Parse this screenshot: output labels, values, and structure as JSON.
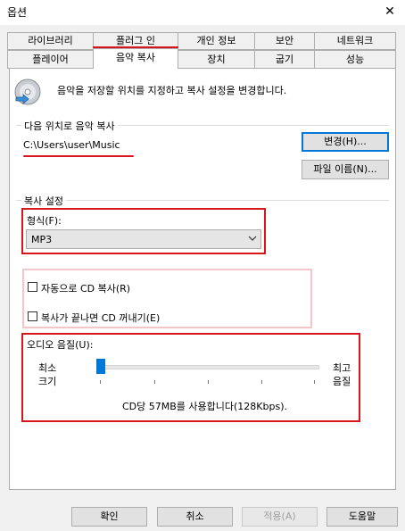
{
  "window": {
    "title": "옵션",
    "close_glyph": "✕"
  },
  "tabs_row1": [
    "라이브러리",
    "플러그 인",
    "개인 정보",
    "보안",
    "네트워크"
  ],
  "tabs_row2": [
    "플레이어",
    "음악 복사",
    "장치",
    "굽기",
    "성능"
  ],
  "active_tab": "음악 복사",
  "header": {
    "description": "음악을 저장할 위치를 지정하고 복사 설정을 변경합니다.",
    "icon": "cd-rip-icon"
  },
  "location": {
    "group_label": "다음 위치로 음악 복사",
    "path": "C:\\Users\\user\\Music",
    "change_button": "변경(H)...",
    "filename_button": "파일 이름(N)..."
  },
  "rip_settings": {
    "group_label": "복사 설정",
    "format_label": "형식(F):",
    "format_value": "MP3",
    "auto_rip_label": "자동으로 CD 복사(R)",
    "auto_rip_checked": false,
    "eject_label": "복사가 끝나면 CD 꺼내기(E)",
    "eject_checked": false,
    "quality_label": "오디오 음질(U):",
    "min_label_line1": "최소",
    "min_label_line2": "크기",
    "max_label_line1": "최고",
    "max_label_line2": "음질",
    "quality_level": 0.0,
    "quality_info": "CD당 57MB를 사용합니다(128Kbps)."
  },
  "footer": {
    "ok": "확인",
    "cancel": "취소",
    "apply": "적용(A)",
    "help": "도움말"
  },
  "colors": {
    "highlight": "#d9161d",
    "accent": "#0078d7"
  }
}
